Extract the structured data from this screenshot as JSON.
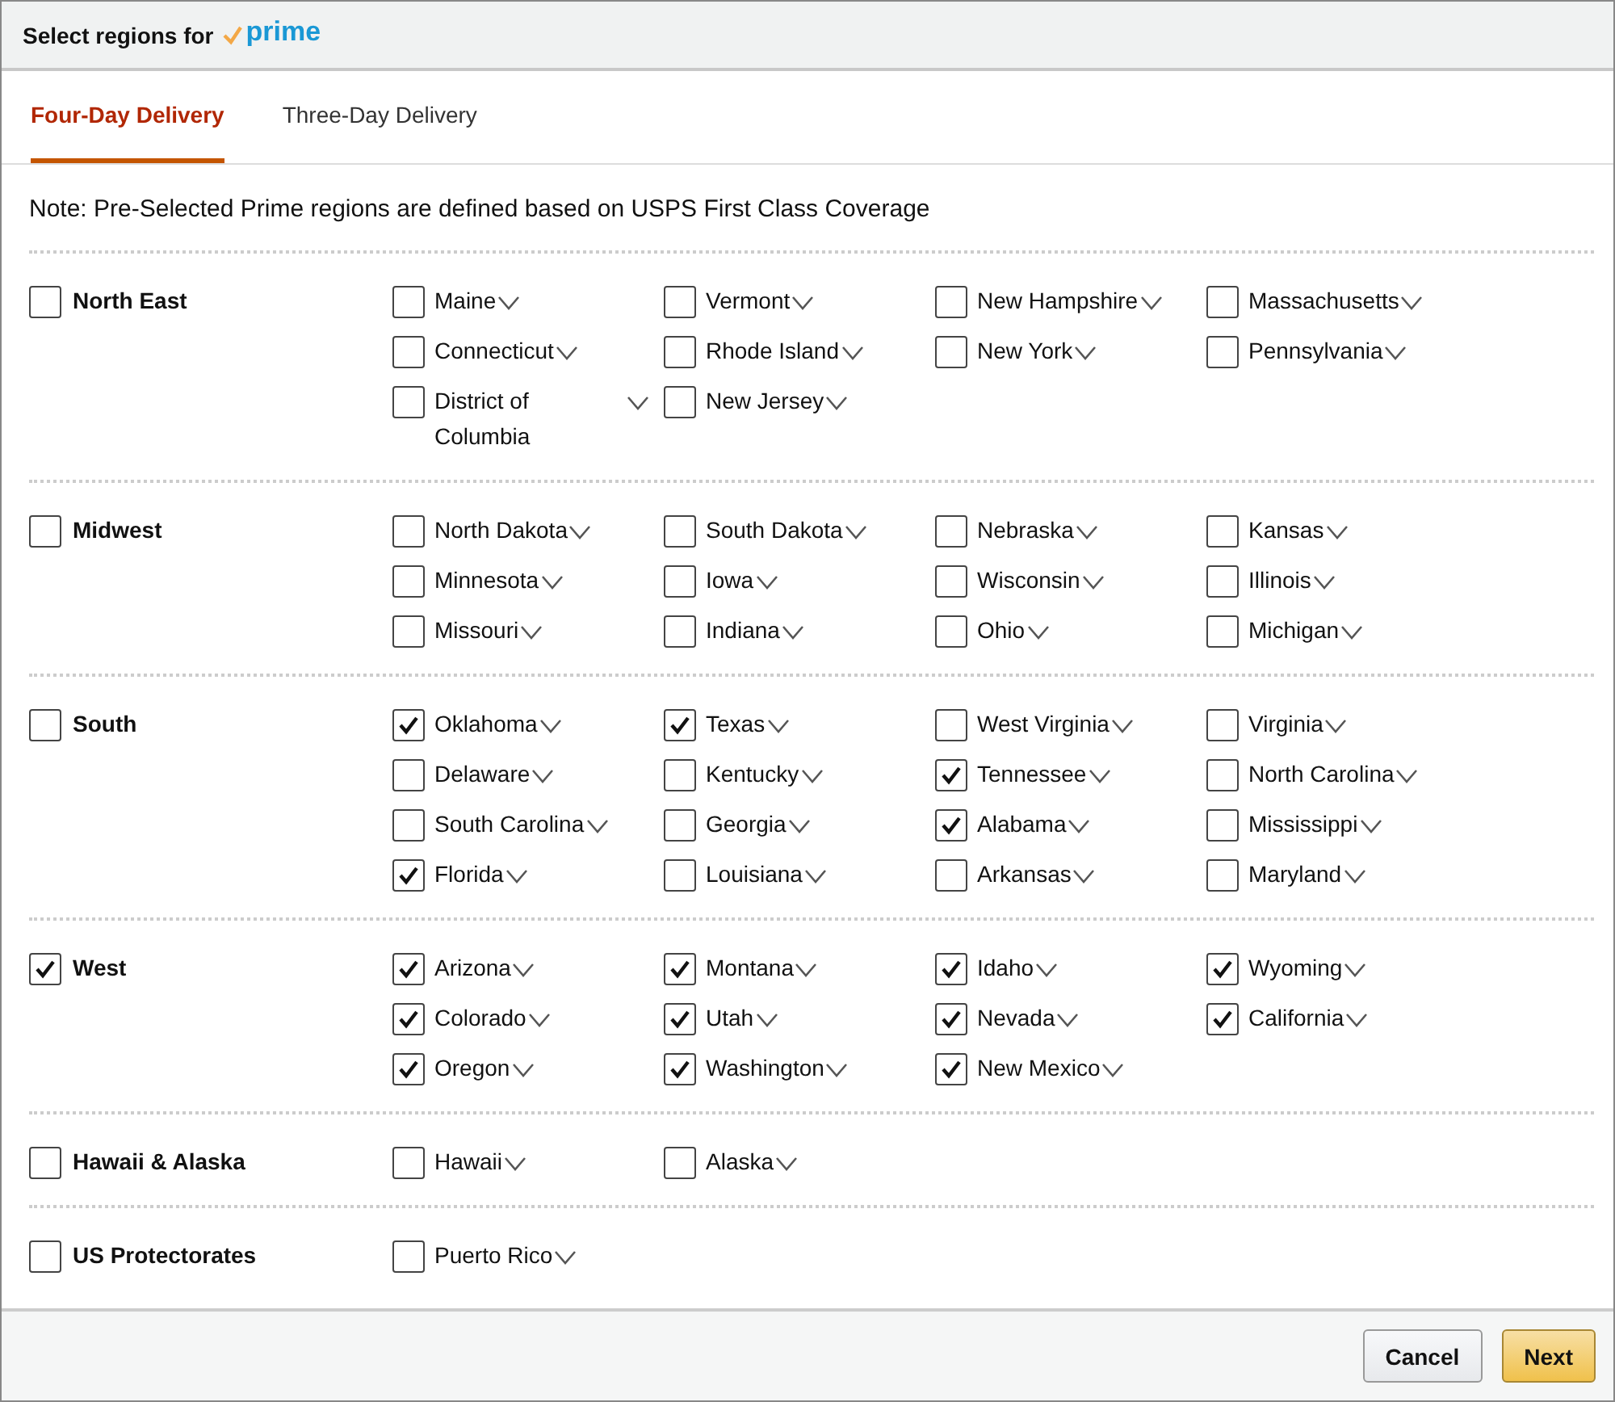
{
  "window": {
    "title": "Select regions for",
    "logo_text": "prime"
  },
  "tabs": [
    {
      "label": "Four-Day Delivery",
      "selected": true
    },
    {
      "label": "Three-Day Delivery",
      "selected": false
    }
  ],
  "note": "Note: Pre-Selected Prime regions are defined based on USPS First Class Coverage",
  "regions": [
    {
      "name": "North East",
      "checked": false,
      "states": [
        {
          "name": "Maine",
          "checked": false
        },
        {
          "name": "Vermont",
          "checked": false
        },
        {
          "name": "New Hampshire",
          "checked": false
        },
        {
          "name": "Massachusetts",
          "checked": false
        },
        {
          "name": "Connecticut",
          "checked": false
        },
        {
          "name": "Rhode Island",
          "checked": false
        },
        {
          "name": "New York",
          "checked": false
        },
        {
          "name": "Pennsylvania",
          "checked": false
        },
        {
          "name": "District of Columbia",
          "checked": false
        },
        {
          "name": "New Jersey",
          "checked": false
        }
      ]
    },
    {
      "name": "Midwest",
      "checked": false,
      "states": [
        {
          "name": "North Dakota",
          "checked": false
        },
        {
          "name": "South Dakota",
          "checked": false
        },
        {
          "name": "Nebraska",
          "checked": false
        },
        {
          "name": "Kansas",
          "checked": false
        },
        {
          "name": "Minnesota",
          "checked": false
        },
        {
          "name": "Iowa",
          "checked": false
        },
        {
          "name": "Wisconsin",
          "checked": false
        },
        {
          "name": "Illinois",
          "checked": false
        },
        {
          "name": "Missouri",
          "checked": false
        },
        {
          "name": "Indiana",
          "checked": false
        },
        {
          "name": "Ohio",
          "checked": false
        },
        {
          "name": "Michigan",
          "checked": false
        }
      ]
    },
    {
      "name": "South",
      "checked": false,
      "states": [
        {
          "name": "Oklahoma",
          "checked": true
        },
        {
          "name": "Texas",
          "checked": true
        },
        {
          "name": "West Virginia",
          "checked": false
        },
        {
          "name": "Virginia",
          "checked": false
        },
        {
          "name": "Delaware",
          "checked": false
        },
        {
          "name": "Kentucky",
          "checked": false
        },
        {
          "name": "Tennessee",
          "checked": true
        },
        {
          "name": "North Carolina",
          "checked": false
        },
        {
          "name": "South Carolina",
          "checked": false
        },
        {
          "name": "Georgia",
          "checked": false
        },
        {
          "name": "Alabama",
          "checked": true
        },
        {
          "name": "Mississippi",
          "checked": false
        },
        {
          "name": "Florida",
          "checked": true
        },
        {
          "name": "Louisiana",
          "checked": false
        },
        {
          "name": "Arkansas",
          "checked": false
        },
        {
          "name": "Maryland",
          "checked": false
        }
      ]
    },
    {
      "name": "West",
      "checked": true,
      "states": [
        {
          "name": "Arizona",
          "checked": true
        },
        {
          "name": "Montana",
          "checked": true
        },
        {
          "name": "Idaho",
          "checked": true
        },
        {
          "name": "Wyoming",
          "checked": true
        },
        {
          "name": "Colorado",
          "checked": true
        },
        {
          "name": "Utah",
          "checked": true
        },
        {
          "name": "Nevada",
          "checked": true
        },
        {
          "name": "California",
          "checked": true
        },
        {
          "name": "Oregon",
          "checked": true
        },
        {
          "name": "Washington",
          "checked": true
        },
        {
          "name": "New Mexico",
          "checked": true
        }
      ]
    },
    {
      "name": "Hawaii & Alaska",
      "checked": false,
      "states": [
        {
          "name": "Hawaii",
          "checked": false
        },
        {
          "name": "Alaska",
          "checked": false
        }
      ]
    },
    {
      "name": "US Protectorates",
      "checked": false,
      "states": [
        {
          "name": "Puerto Rico",
          "checked": false
        }
      ]
    }
  ],
  "buttons": [
    {
      "label": "Cancel",
      "kind": "secondary"
    },
    {
      "label": "Next",
      "kind": "primary"
    }
  ]
}
